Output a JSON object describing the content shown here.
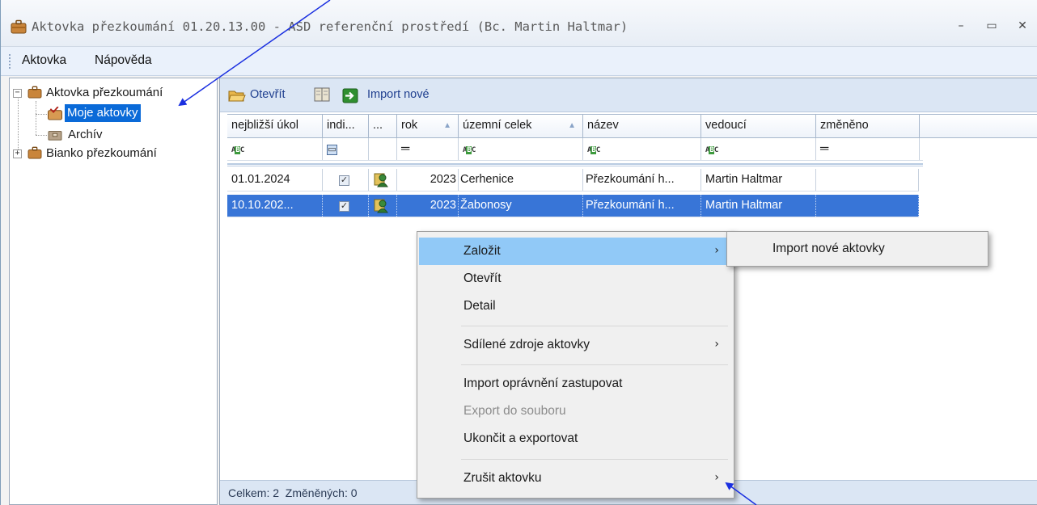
{
  "window": {
    "title": "Aktovka přezkoumání 01.20.13.00 - ASD referenční prostředí (Bc. Martin Haltmar)",
    "controls": [
      "–",
      "▭",
      "✕"
    ]
  },
  "menubar": {
    "items": [
      "Aktovka",
      "Nápověda"
    ]
  },
  "tree": {
    "root1": "Aktovka přezkoumání",
    "child1": "Moje aktovky",
    "child2": "Archív",
    "root2": "Bianko přezkoumání"
  },
  "toolbar": {
    "open_label": "Otevřít",
    "import_label": "Import nové"
  },
  "grid": {
    "columns": [
      "nejbližší úkol",
      "indi...",
      "...",
      "rok",
      "územní celek",
      "název",
      "vedoucí",
      "změněno"
    ],
    "filter_eq": "═",
    "rows": [
      {
        "ukol": "01.01.2024",
        "rok": "2023",
        "celek": "Cerhenice",
        "nazev": "Přezkoumání h...",
        "vedouci": "Martin Haltmar",
        "zmeneno": ""
      },
      {
        "ukol": "10.10.202...",
        "rok": "2023",
        "celek": "Žabonosy",
        "nazev": "Přezkoumání h...",
        "vedouci": "Martin Haltmar",
        "zmeneno": ""
      }
    ]
  },
  "status": {
    "text": "Celkem: 2  Změněných: 0"
  },
  "context_menu": {
    "items": [
      {
        "label": "Založit",
        "has_submenu": true,
        "highlighted": true
      },
      {
        "label": "Otevřít"
      },
      {
        "label": "Detail"
      },
      {
        "label": "Sdílené zdroje aktovky",
        "has_submenu": true
      },
      {
        "label": "Import oprávnění zastupovat"
      },
      {
        "label": "Export do souboru",
        "disabled": true
      },
      {
        "label": "Ukončit a exportovat"
      },
      {
        "label": "Zrušit aktovku",
        "has_submenu": true
      }
    ],
    "submenu_arrow": "›",
    "submenu": {
      "label": "Import nové aktovky"
    }
  },
  "colors": {
    "selection": "#3875d7",
    "tree_selection": "#0a6ad8",
    "menu_highlight": "#91c9f7",
    "annotation_arrow": "#1a2fe0"
  },
  "icons": [
    "briefcase-icon",
    "folder-open-icon",
    "book-icon",
    "import-arrow-icon",
    "user-icon",
    "abc-filter-icon",
    "checkbox-icon"
  ]
}
